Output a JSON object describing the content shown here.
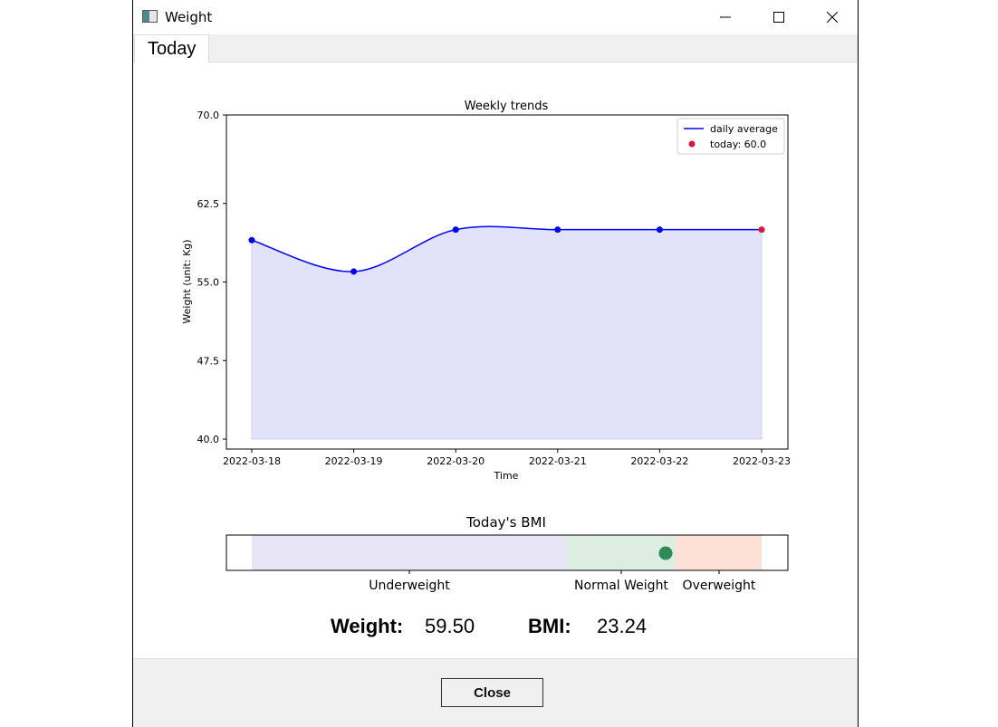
{
  "window": {
    "title": "Weight",
    "app_icon": "app-window-icon",
    "controls": {
      "minimize": "minimize-icon",
      "maximize": "maximize-icon",
      "close": "close-icon"
    }
  },
  "tabs": [
    {
      "label": "Today"
    }
  ],
  "chart_data": {
    "type": "line",
    "title": "Weekly trends",
    "xlabel": "Time",
    "ylabel": "Weight (unit: Kg)",
    "x": [
      "2022-03-18",
      "2022-03-19",
      "2022-03-20",
      "2022-03-21",
      "2022-03-22",
      "2022-03-23"
    ],
    "series": [
      {
        "name": "daily average",
        "values": [
          59.0,
          56.0,
          60.0,
          60.0,
          60.0,
          60.0
        ],
        "color": "#0000ff",
        "fill": "#e2e2fb"
      },
      {
        "name": "today: 60.0",
        "values": [
          null,
          null,
          null,
          null,
          null,
          60.0
        ],
        "color": "#dc143c"
      }
    ],
    "ylim": [
      40.0,
      70.0
    ],
    "yticks": [
      "40.0",
      "47.5",
      "55.0",
      "62.5",
      "70.0"
    ],
    "legend": "top-right",
    "grid": false
  },
  "bmi": {
    "title": "Today's BMI",
    "bands": [
      {
        "label": "Underweight",
        "color": "#e7e5f5"
      },
      {
        "label": "Normal Weight",
        "color": "#ddede2"
      },
      {
        "label": "Overweight",
        "color": "#fde1d6"
      }
    ],
    "marker_color": "#2e8b57",
    "value": 23.24
  },
  "summary": {
    "weight_label": "Weight:",
    "weight_value": "59.50",
    "bmi_label": "BMI:",
    "bmi_value": "23.24"
  },
  "footer": {
    "close_label": "Close"
  }
}
